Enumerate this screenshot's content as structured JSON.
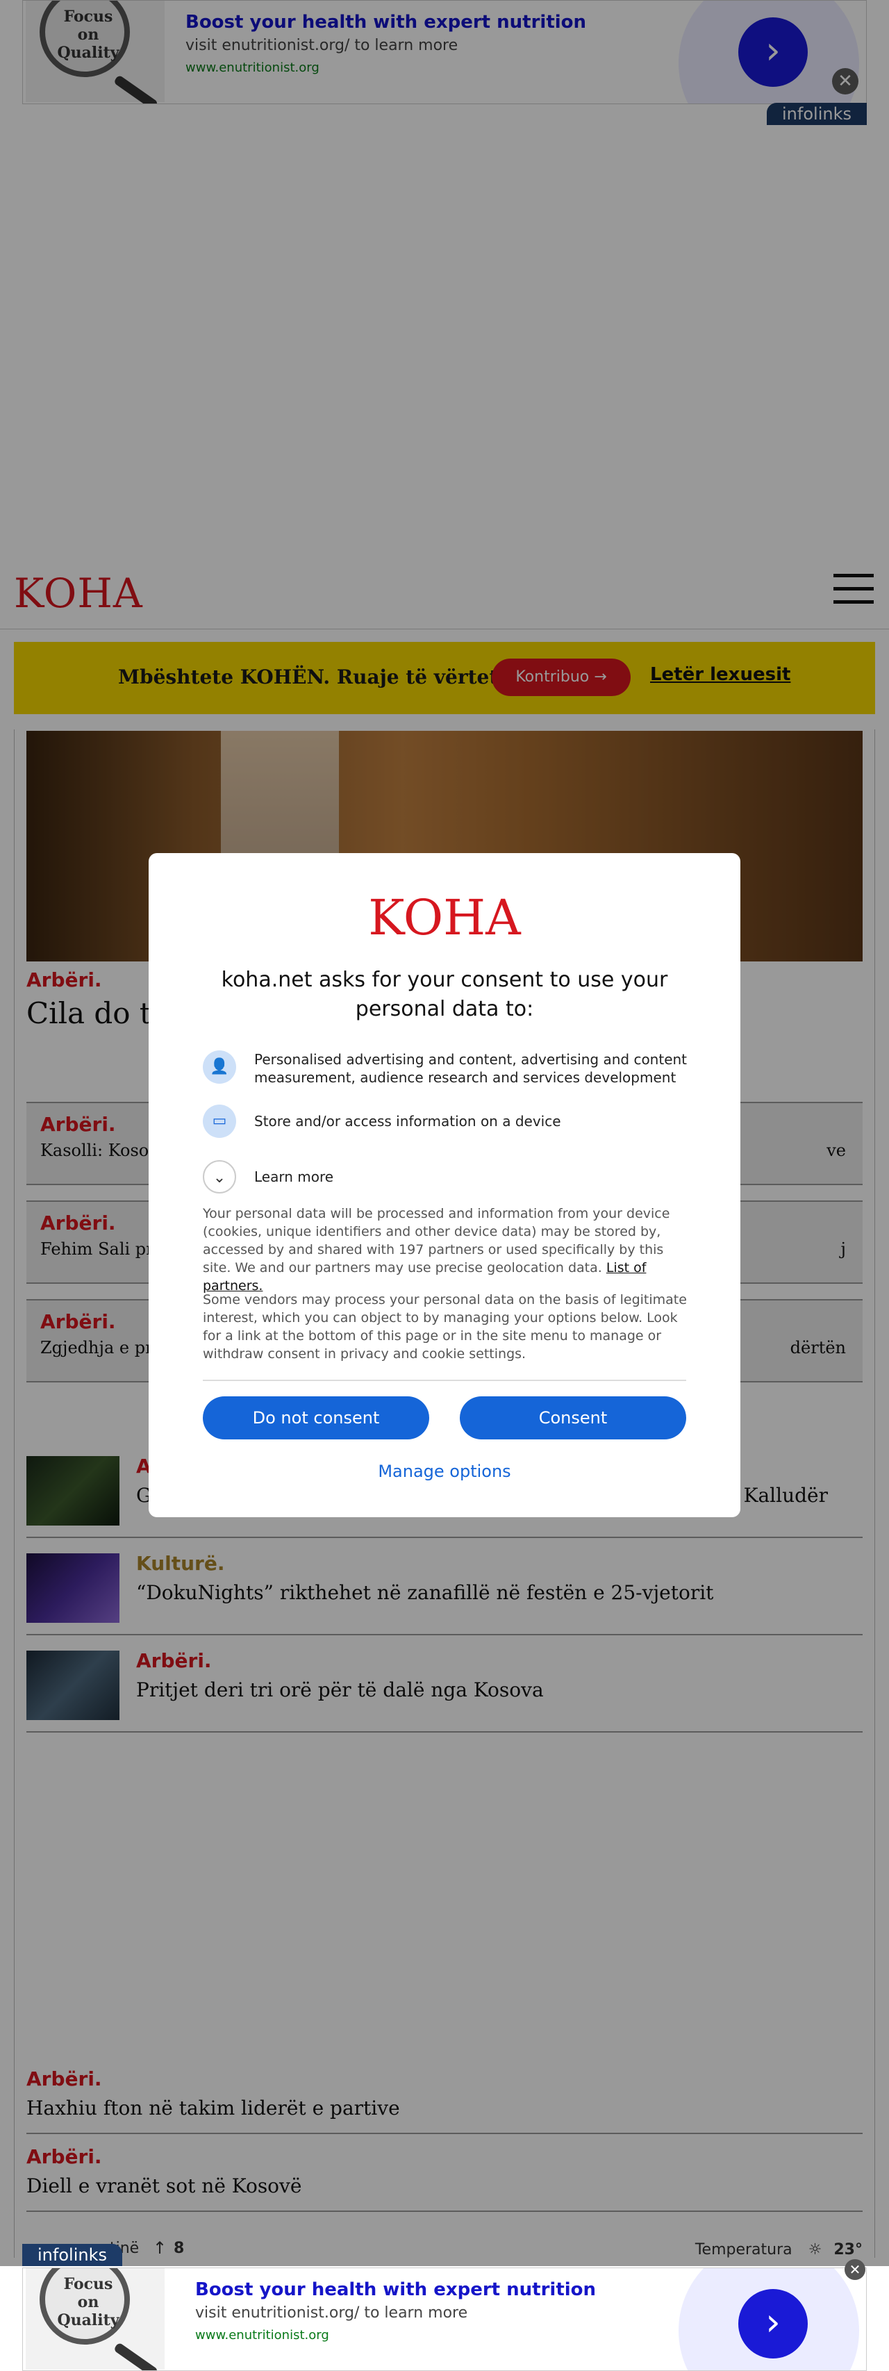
{
  "ad": {
    "image_text": "Focus on Quality",
    "title": "Boost your health with expert nutrition",
    "subtitle": "visit enutritionist.org/ to learn more",
    "url": "www.enutritionist.org",
    "go_icon": "chevron-right-icon",
    "close_glyph": "✕",
    "infolinks": "infolinks"
  },
  "header": {
    "logo": "KOHA",
    "menu_icon": "hamburger-icon"
  },
  "support": {
    "message": "Mbështete KOHËN. Ruaje të vërtetën",
    "button": "Kontribuo →",
    "letter": "Letër lexuesit"
  },
  "lead": {
    "category": "Arbëri.",
    "title": "Cila do të"
  },
  "cards": [
    {
      "category": "Arbëri.",
      "title": "Kasolli: Kosov",
      "right": "ve"
    },
    {
      "category": "Arbëri.",
      "title": "Fehim Sali pr",
      "right": "j"
    },
    {
      "category": "Arbëri.",
      "title": "Zgjedhja e pre",
      "right": "dërtën"
    }
  ],
  "list": [
    {
      "category": "A",
      "title": "G",
      "right": "e Kalludër",
      "color": "#d6171f"
    },
    {
      "category": "Kulturë.",
      "title": "“DokuNights” rikthehet në zanafillë në festën e 25-vjetorit",
      "color": "#a8842a"
    },
    {
      "category": "Arbëri.",
      "title": "Pritjet deri tri orë për të dalë nga Kosova",
      "color": "#d6171f"
    }
  ],
  "small_list": [
    {
      "category": "Arbëri.",
      "title": "Haxhiu fton në takim liderët e partive"
    },
    {
      "category": "Arbëri.",
      "title": "Diell e vranët sot në Kosovë"
    }
  ],
  "footer": {
    "left_text": "tinë",
    "arrow": "↑",
    "count": "8",
    "weather_label": "Temperatura",
    "weather_icon": "sun-icon",
    "temperature": "23°"
  },
  "consent": {
    "logo": "KOHA",
    "heading": "koha.net asks for your consent to use your personal data to:",
    "purposes": [
      {
        "icon": "person-icon",
        "label": "Personalised advertising and content, advertising and content measurement, audience research and services development"
      },
      {
        "icon": "devices-icon",
        "label": "Store and/or access information on a device"
      }
    ],
    "learn_more": "Learn more",
    "paragraph1": "Your personal data will be processed and information from your device (cookies, unique identifiers and other device data) may be stored by, accessed by and shared with 197 partners or used specifically by this site. We and our partners may use precise geolocation data.",
    "partners_link": "List of partners.",
    "paragraph2": "Some vendors may process your personal data on the basis of legitimate interest, which you can object to by managing your options below. Look for a link at the bottom of this page or in the site menu to manage or withdraw consent in privacy and cookie settings.",
    "do_not_consent": "Do not consent",
    "consent": "Consent",
    "manage": "Manage options"
  }
}
